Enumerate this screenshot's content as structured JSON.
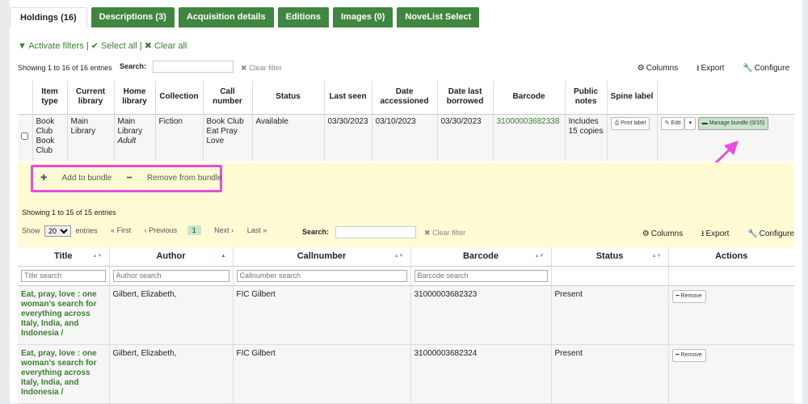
{
  "tabs": [
    "Holdings (16)",
    "Descriptions (3)",
    "Acquisition details",
    "Editions",
    "Images (0)",
    "NoveList Select"
  ],
  "filters": {
    "activate": "Activate filters",
    "select_all": "Select all",
    "clear_all": "Clear all"
  },
  "holdings": {
    "info": "Showing 1 to 16 of 16 entries",
    "search_label": "Search:",
    "clear_filter": "Clear filter",
    "columns": "Columns",
    "export": "Export",
    "configure": "Configure",
    "headers": [
      "Item type",
      "Current library",
      "Home library",
      "Collection",
      "Call number",
      "Status",
      "Last seen",
      "Date accessioned",
      "Date last borrowed",
      "Barcode",
      "Public notes",
      "Spine label"
    ],
    "row": {
      "item_type": "Book Club Book Club",
      "current_library": "Main Library",
      "home_library": "Main Library",
      "home_library_loc": "Adult",
      "collection": "Fiction",
      "call_number": "Book Club Eat Pray Love",
      "status": "Available",
      "last_seen": "03/30/2023",
      "date_accessioned": "03/10/2023",
      "date_last_borrowed": "03/30/2023",
      "barcode": "31000003682338",
      "public_notes": "Includes 15 copies",
      "print_label": "Print label",
      "edit": "Edit",
      "manage_bundle": "Manage bundle (0/15)"
    }
  },
  "bundle": {
    "add": "Add to bundle",
    "remove": "Remove from bundle"
  },
  "bundle_table": {
    "info": "Showing 1 to 15 of 15 entries",
    "show": "Show",
    "page_size": "20",
    "entries": "entries",
    "first": "« First",
    "previous": "‹ Previous",
    "current_page": "1",
    "next": "Next ›",
    "last": "Last »",
    "search_label": "Search:",
    "clear_filter": "Clear filter",
    "columns": "Columns",
    "export": "Export",
    "configure": "Configure",
    "headers": [
      "Title",
      "Author",
      "Callnumber",
      "Barcode",
      "Status",
      "Actions"
    ],
    "filter_placeholders": [
      "Title search",
      "Author search",
      "Callnumber search",
      "Barcode search"
    ],
    "rows": [
      {
        "title": "Eat, pray, love : one woman's search for everything across Italy, India, and Indonesia /",
        "author": "Gilbert, Elizabeth,",
        "callnumber": "FIC Gilbert",
        "barcode": "31000003682323",
        "status": "Present",
        "action": "Remove"
      },
      {
        "title": "Eat, pray, love : one woman's search for everything across Italy, India, and Indonesia /",
        "author": "Gilbert, Elizabeth,",
        "callnumber": "FIC Gilbert",
        "barcode": "31000003682324",
        "status": "Present",
        "action": "Remove"
      }
    ]
  },
  "colors": {
    "tab_green": "#408540",
    "link_green": "#3b7d31",
    "highlight": "#fffbd5",
    "annotation": "#e64dd9"
  }
}
